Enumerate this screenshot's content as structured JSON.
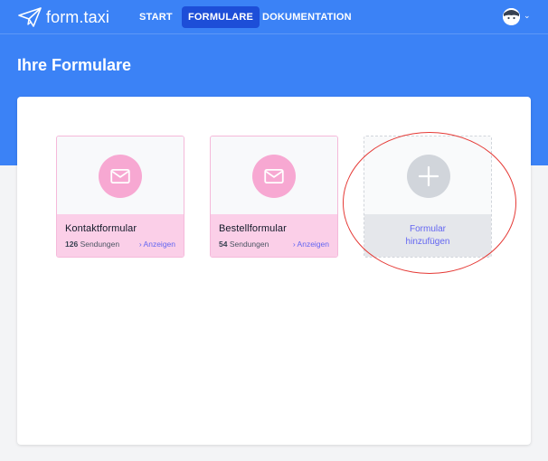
{
  "app": {
    "name": "form.taxi"
  },
  "nav": {
    "items": [
      {
        "label": "START",
        "active": false
      },
      {
        "label": "FORMULARE",
        "active": true
      },
      {
        "label": "DOKUMENTATION",
        "active": false
      }
    ]
  },
  "page": {
    "title": "Ihre Formulare"
  },
  "forms": [
    {
      "name": "Kontaktformular",
      "count": "126",
      "count_label": "Sendungen",
      "link": "› Anzeigen",
      "icon": "mail-icon"
    },
    {
      "name": "Bestellformular",
      "count": "54",
      "count_label": "Sendungen",
      "link": "› Anzeigen",
      "icon": "mail-icon"
    }
  ],
  "add_form": {
    "label_line1": "Formular",
    "label_line2": "hinzufügen",
    "icon": "plus-icon"
  },
  "colors": {
    "brand_blue": "#3b82f6",
    "nav_active": "#1d4ed8",
    "card_pink": "#fbcfe8",
    "icon_pink": "#f7a8d2",
    "link": "#6366f1",
    "annotation_red": "#e53935"
  }
}
